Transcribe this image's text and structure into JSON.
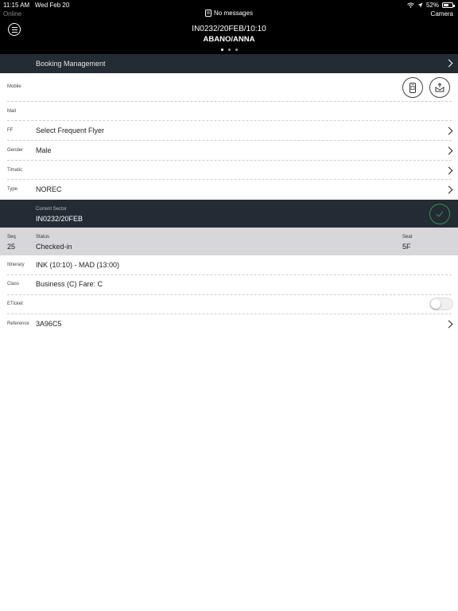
{
  "status_bar": {
    "time": "11:15 AM",
    "date": "Wed Feb 20",
    "battery": "52%",
    "connection": "Online",
    "camera": "Camera",
    "messages": "No messages"
  },
  "header": {
    "flight": "IN0232/20FEB/10:10",
    "passenger": "ABANO/ANNA",
    "page_dots": 3,
    "active_dot": 0
  },
  "booking_management": {
    "label": "Booking Management"
  },
  "fields": [
    {
      "key": "Mobile",
      "value": ""
    },
    {
      "key": "Mail",
      "value": ""
    },
    {
      "key": "FF",
      "value": "Select Frequent Flyer"
    },
    {
      "key": "Gender",
      "value": "Male"
    },
    {
      "key": "Timatic",
      "value": ""
    },
    {
      "key": "Type",
      "value": "NOREC"
    }
  ],
  "current_sector": {
    "label": "Current Sector",
    "value": "IN0232/20FEB"
  },
  "segment": {
    "seq_label": "Seq",
    "seq_value": "25",
    "status_label": "Status",
    "status_value": "Checked-in",
    "seat_label": "Seat",
    "seat_value": "5F"
  },
  "details": [
    {
      "key": "Itinerary",
      "value": "INK (10:10) - MAD (13:00)"
    },
    {
      "key": "Class",
      "value": "Business (C) Fare: C"
    },
    {
      "key": "ETicket",
      "value": ""
    },
    {
      "key": "Reference",
      "value": "3A96C5"
    }
  ],
  "eticket_toggle": false,
  "colors": {
    "header_bg": "#000000",
    "section_bg": "#232b34",
    "segment_bg": "#d7d7d9",
    "check_green": "#3a8f4a"
  }
}
